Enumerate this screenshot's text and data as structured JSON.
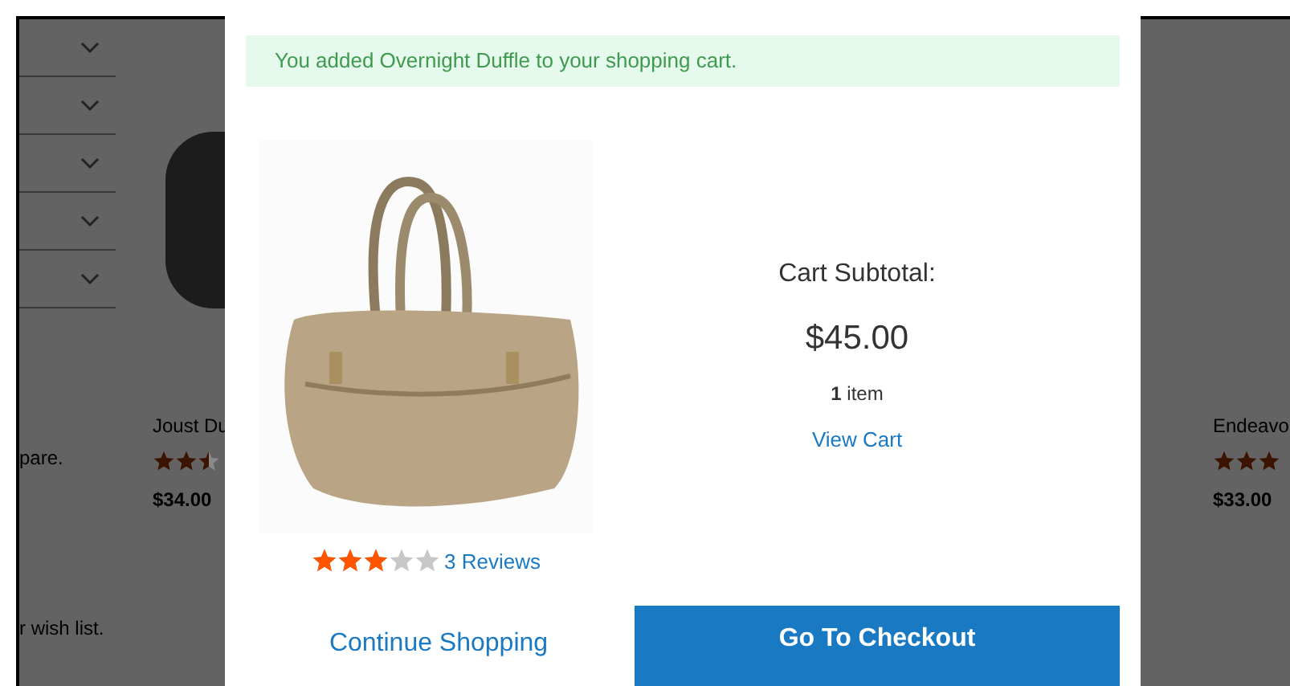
{
  "sidebar": {
    "filters": [
      {
        "expanded": false
      },
      {
        "expanded": false
      },
      {
        "expanded": false
      },
      {
        "expanded": false
      },
      {
        "expanded": false
      }
    ],
    "compare_text": "pare.",
    "wishlist_text": "r wish list."
  },
  "products": [
    {
      "name": "Joust Du",
      "stars": 2.5,
      "price": "$34.00"
    },
    {
      "name": "Endeavo",
      "stars": 3,
      "price": "$33.00"
    }
  ],
  "modal": {
    "message": "You added Overnight Duffle to your shopping cart.",
    "product": {
      "stars": 3,
      "reviews": "3 Reviews"
    },
    "cart": {
      "label": "Cart Subtotal:",
      "subtotal": "$45.00",
      "count": "**1** item",
      "view_cart": "View Cart"
    },
    "continue": "Continue Shopping",
    "checkout": "Go To Checkout"
  }
}
